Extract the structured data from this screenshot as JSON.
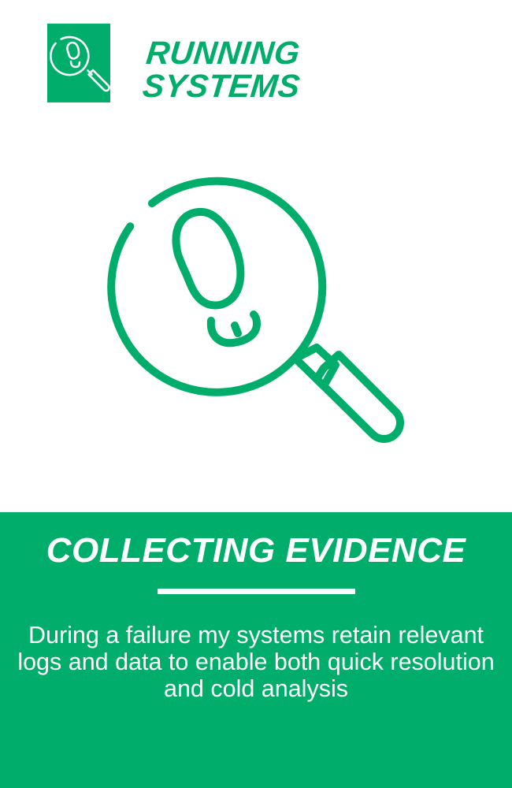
{
  "brand": {
    "logo_icon": "footprint-magnifier-icon",
    "line1": "RUNNING",
    "line2": "SYSTEMS"
  },
  "hero": {
    "icon": "footprint-magnifier-icon"
  },
  "panel": {
    "title": "COLLECTING EVIDENCE",
    "description": "During a failure my systems retain relevant logs and data to enable both quick resolution and cold analysis"
  },
  "colors": {
    "accent": "#00ad6b",
    "background": "#ffffff",
    "text_on_accent": "#ffffff"
  }
}
